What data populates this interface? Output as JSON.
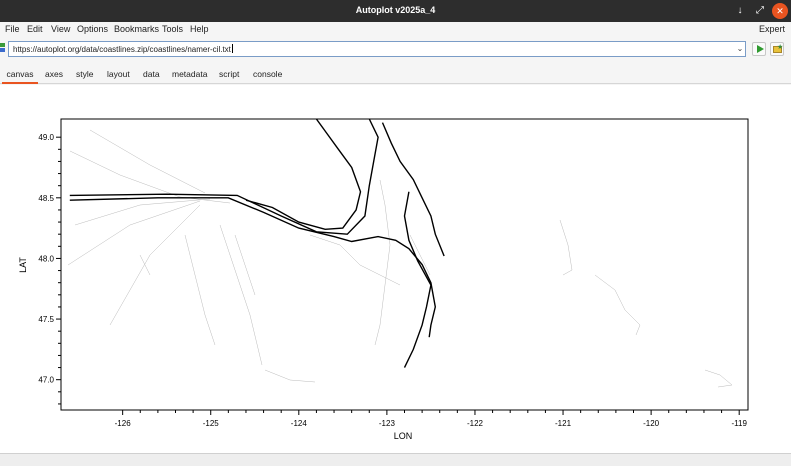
{
  "window": {
    "title": "Autoplot v2025a_4",
    "controls": [
      "minimize-icon",
      "maximize-icon",
      "close-icon"
    ]
  },
  "menubar": {
    "items": [
      "File",
      "Edit",
      "View",
      "Options",
      "Bookmarks",
      "Tools",
      "Help"
    ],
    "expert_label": "Expert"
  },
  "url": {
    "value": "https://autoplot.org/data/coastlines.zip/coastlines/namer-cil.txt",
    "dropdown_icon": "chevron-down-icon",
    "go_icon": "play-icon",
    "bookmark_icon": "bookmark-folder-icon"
  },
  "tabs": {
    "items": [
      "canvas",
      "axes",
      "style",
      "layout",
      "data",
      "metadata",
      "script",
      "console"
    ],
    "active": "canvas"
  },
  "plot": {
    "xlabel": "LON",
    "ylabel": "LAT",
    "xticks": [
      "-126",
      "-125",
      "-124",
      "-123",
      "-122",
      "-121",
      "-120",
      "-119"
    ],
    "yticks": [
      "49.0",
      "48.5",
      "48.0",
      "47.5",
      "47.0"
    ],
    "line_color": "#000000"
  },
  "chart_data": {
    "type": "line",
    "title": "",
    "xlabel": "LON",
    "ylabel": "LAT",
    "xlim": [
      -126.7,
      -118.9
    ],
    "ylim": [
      46.75,
      49.15
    ],
    "grid": false,
    "series": [
      {
        "values": [
          [
            -126.6,
            48.48
          ],
          [
            -125.6,
            48.5
          ],
          [
            -124.8,
            48.5
          ],
          [
            -124.4,
            48.38
          ],
          [
            -124.0,
            48.25
          ],
          [
            -123.6,
            48.18
          ],
          [
            -123.4,
            48.14
          ],
          [
            -123.1,
            48.18
          ],
          [
            -122.9,
            48.15
          ],
          [
            -122.75,
            48.08
          ],
          [
            -122.6,
            47.95
          ],
          [
            -122.5,
            47.8
          ],
          [
            -122.45,
            47.6
          ],
          [
            -122.5,
            47.45
          ],
          [
            -122.52,
            47.35
          ]
        ]
      },
      {
        "values": [
          [
            -126.6,
            48.52
          ],
          [
            -125.5,
            48.53
          ],
          [
            -124.7,
            48.52
          ],
          [
            -124.2,
            48.35
          ],
          [
            -123.8,
            48.22
          ],
          [
            -123.45,
            48.2
          ],
          [
            -123.25,
            48.35
          ],
          [
            -123.2,
            48.6
          ],
          [
            -123.15,
            48.8
          ],
          [
            -123.1,
            49.0
          ],
          [
            -123.2,
            49.15
          ]
        ]
      },
      {
        "values": [
          [
            -123.05,
            49.12
          ],
          [
            -122.95,
            48.95
          ],
          [
            -122.85,
            48.8
          ],
          [
            -122.7,
            48.65
          ],
          [
            -122.6,
            48.5
          ],
          [
            -122.5,
            48.35
          ],
          [
            -122.45,
            48.2
          ],
          [
            -122.35,
            48.02
          ]
        ]
      },
      {
        "values": [
          [
            -122.75,
            48.55
          ],
          [
            -122.8,
            48.35
          ],
          [
            -122.75,
            48.15
          ],
          [
            -122.65,
            47.98
          ],
          [
            -122.5,
            47.78
          ],
          [
            -122.55,
            47.6
          ],
          [
            -122.6,
            47.45
          ],
          [
            -122.7,
            47.25
          ],
          [
            -122.8,
            47.1
          ]
        ]
      },
      {
        "values": [
          [
            -124.6,
            48.48
          ],
          [
            -124.3,
            48.42
          ],
          [
            -124.0,
            48.3
          ],
          [
            -123.7,
            48.24
          ],
          [
            -123.5,
            48.25
          ],
          [
            -123.35,
            48.4
          ],
          [
            -123.3,
            48.55
          ],
          [
            -123.4,
            48.75
          ],
          [
            -123.55,
            48.9
          ],
          [
            -123.7,
            49.05
          ],
          [
            -123.8,
            49.15
          ]
        ]
      }
    ]
  }
}
